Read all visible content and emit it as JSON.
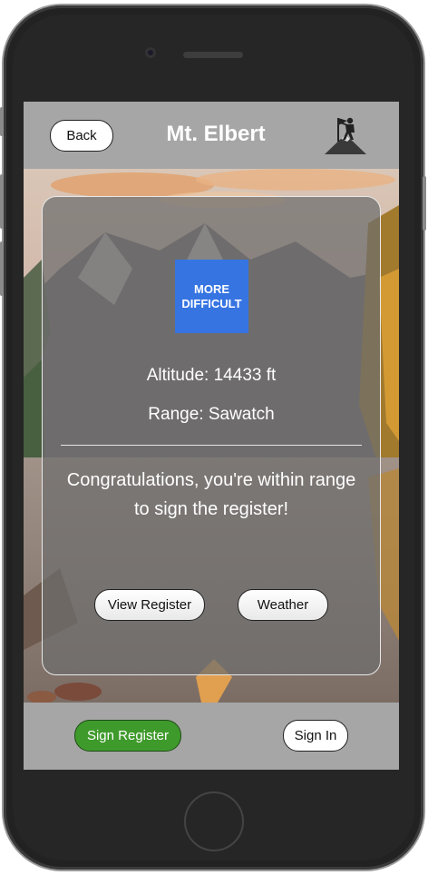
{
  "header": {
    "back_label": "Back",
    "title": "Mt. Elbert",
    "hiker_icon": "hiker-summit-icon"
  },
  "card": {
    "difficulty_badge": {
      "line1": "MORE",
      "line2": "DIFFICULT",
      "color": "#3674e2"
    },
    "altitude": "Altitude: 14433 ft",
    "range": "Range: Sawatch",
    "message": "Congratulations, you're within range to sign the register!",
    "view_register_label": "View Register",
    "weather_label": "Weather"
  },
  "footer": {
    "sign_register_label": "Sign Register",
    "sign_register_color": "#3f9a2c",
    "sign_in_label": "Sign In"
  }
}
